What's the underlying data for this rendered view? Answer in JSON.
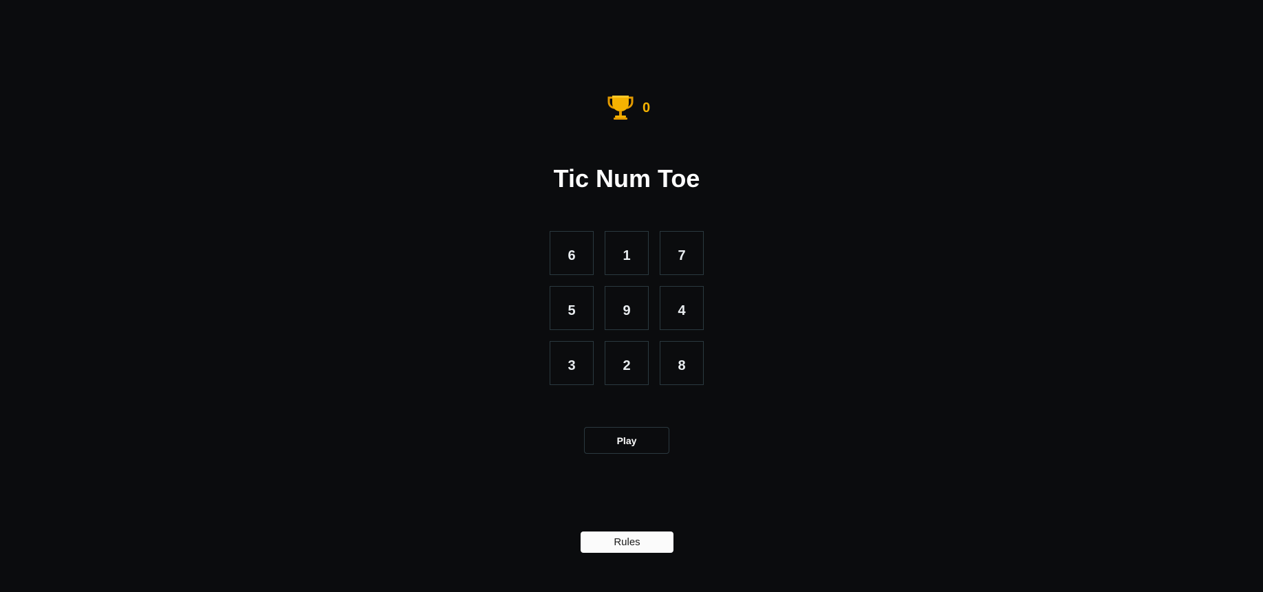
{
  "score": {
    "icon": "trophy-icon",
    "value": "0",
    "color": "#f5b301"
  },
  "title": "Tic Num Toe",
  "board": {
    "cells": [
      "6",
      "1",
      "7",
      "5",
      "9",
      "4",
      "3",
      "2",
      "8"
    ]
  },
  "buttons": {
    "play_label": "Play",
    "rules_label": "Rules"
  },
  "colors": {
    "background": "#0b0c0e",
    "cell_border": "#2b3a40",
    "accent": "#f5b301"
  }
}
